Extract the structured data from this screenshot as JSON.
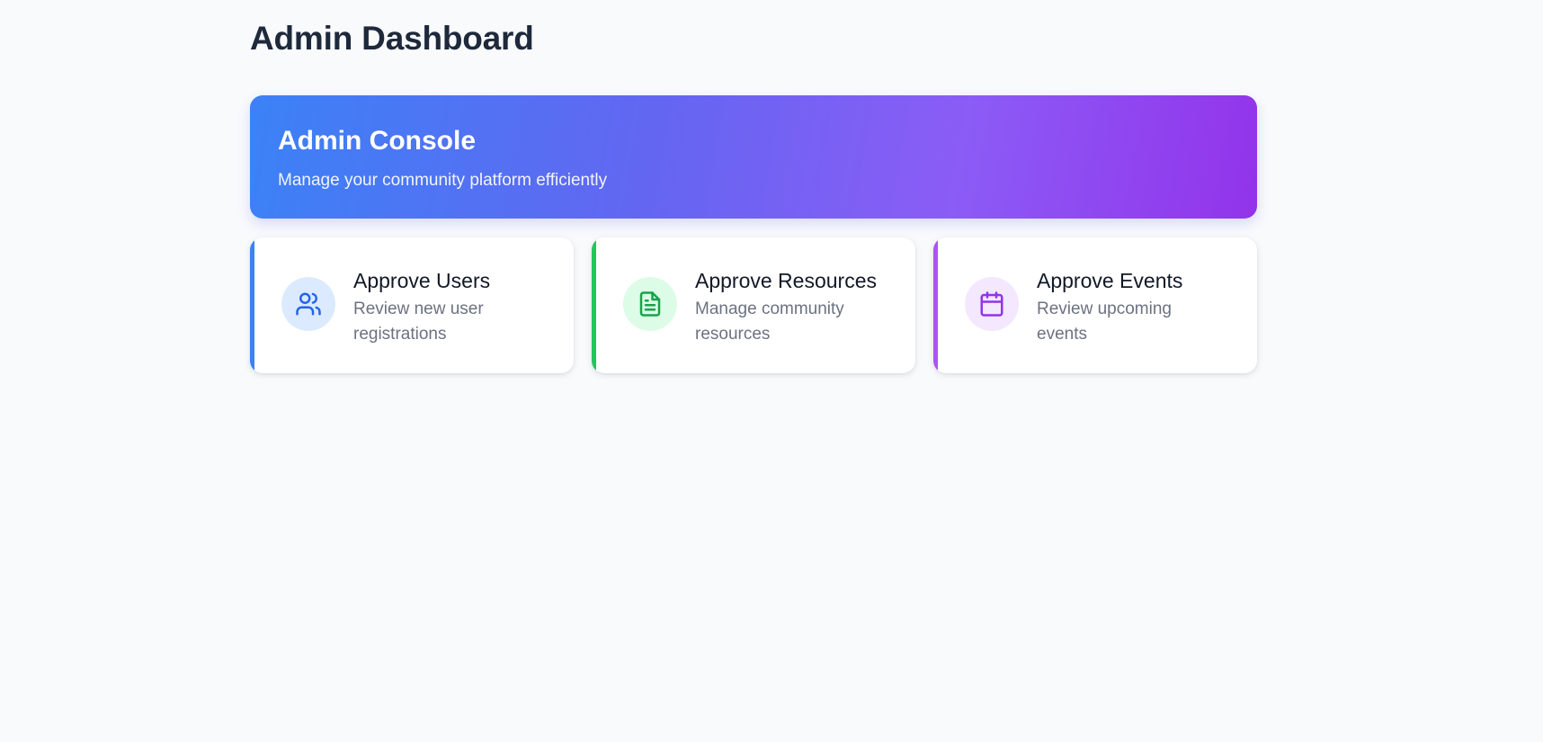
{
  "page": {
    "title": "Admin Dashboard"
  },
  "hero": {
    "title": "Admin Console",
    "subtitle": "Manage your community platform efficiently",
    "gradient_colors": [
      "#3b82f6",
      "#9333ea"
    ]
  },
  "cards": [
    {
      "title": "Approve Users",
      "description": "Review new user registrations",
      "icon": "users-icon",
      "accent": "#3b82f6"
    },
    {
      "title": "Approve Resources",
      "description": "Manage community resources",
      "icon": "document-icon",
      "accent": "#22c55e"
    },
    {
      "title": "Approve Events",
      "description": "Review upcoming events",
      "icon": "calendar-icon",
      "accent": "#a855f7"
    }
  ]
}
